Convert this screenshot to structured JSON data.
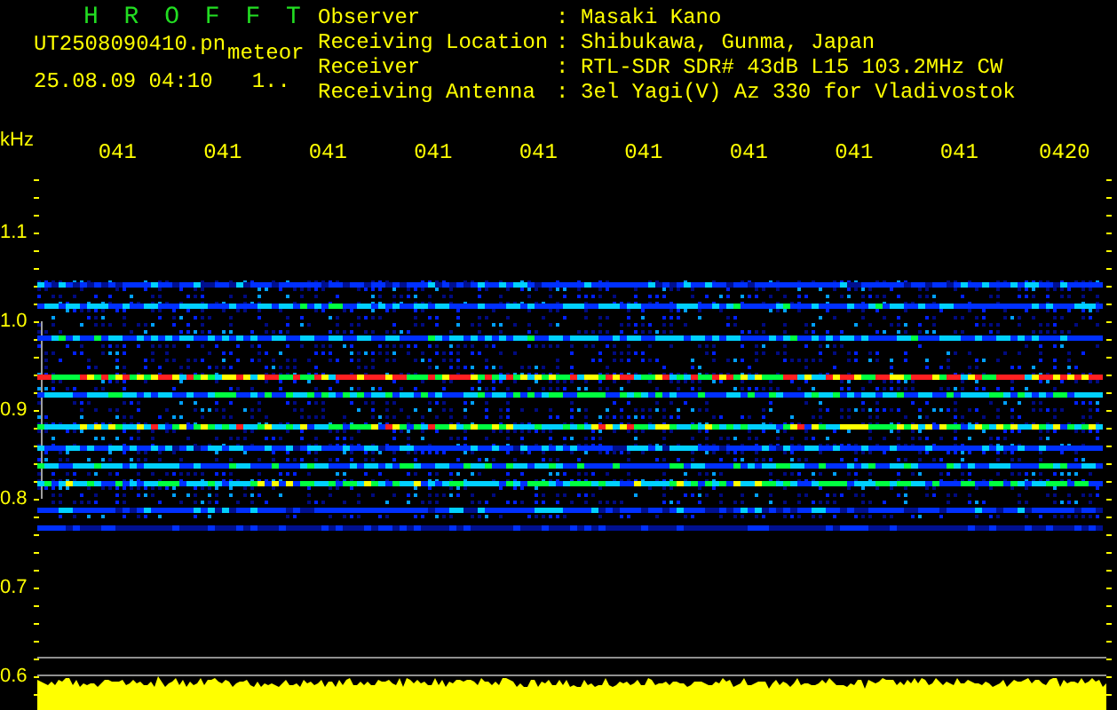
{
  "header": {
    "title": "H R O F F T",
    "filename": "UT2508090410.pn",
    "mode": "meteor",
    "datetime": "25.08.09 04:10",
    "counter": "1.."
  },
  "info": {
    "separator": ":",
    "rows": [
      {
        "label": "Observer",
        "value": "Masaki Kano"
      },
      {
        "label": "Receiving Location",
        "value": "Shibukawa, Gunma, Japan"
      },
      {
        "label": "Receiver",
        "value": "RTL-SDR SDR# 43dB L15 103.2MHz CW"
      },
      {
        "label": "Receiving Antenna",
        "value": "3el Yagi(V) Az 330 for Vladivostok"
      }
    ]
  },
  "axis": {
    "unit": "kHz",
    "time_labels": [
      "041",
      "041",
      "041",
      "041",
      "041",
      "041",
      "041",
      "041",
      "041",
      "0420"
    ],
    "freq_labels": [
      "1.1",
      "1.0",
      "0.9",
      "0.8",
      "0.7",
      "0.6"
    ]
  }
}
